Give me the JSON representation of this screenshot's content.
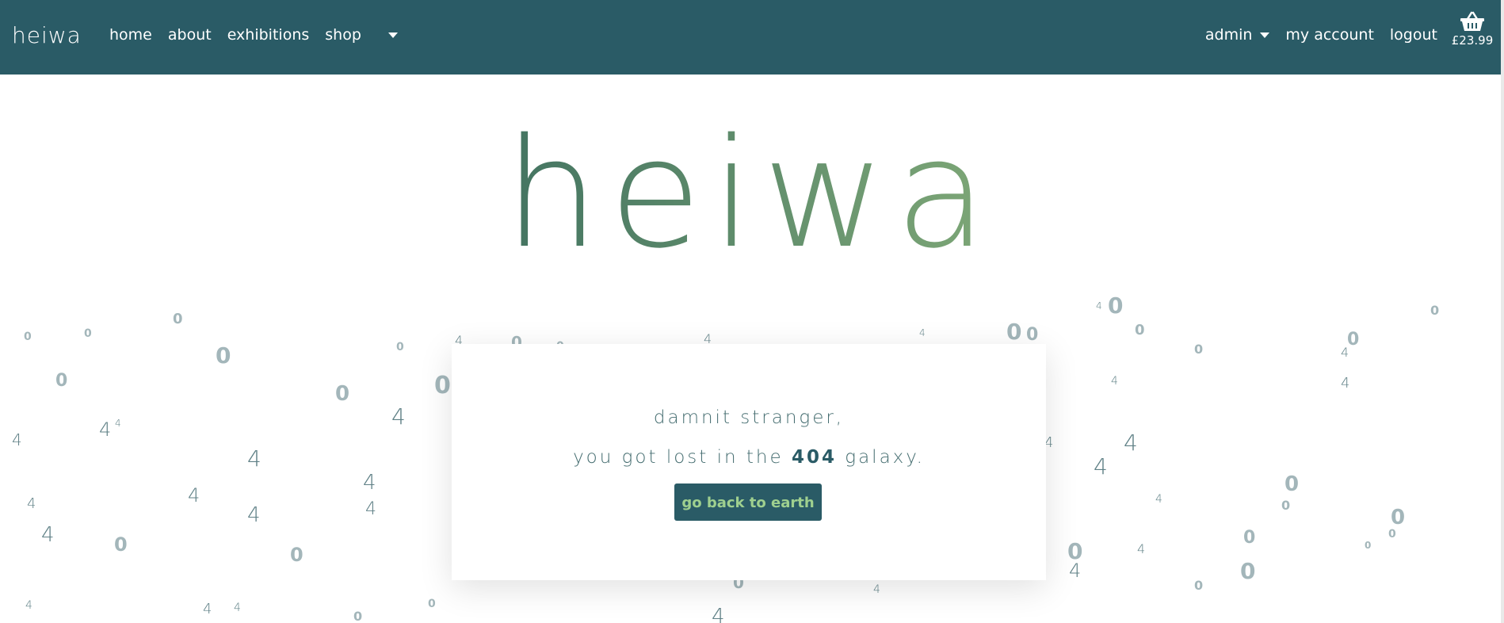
{
  "navbar": {
    "brand": "heiwa",
    "links": {
      "home": "home",
      "about": "about",
      "exhibitions": "exhibitions",
      "shop": "shop"
    },
    "admin": "admin",
    "my_account": "my account",
    "logout": "logout",
    "basket_total": "£23.99"
  },
  "hero": {
    "logo": "heiwa"
  },
  "error": {
    "line1": "damnit stranger,",
    "line2_before": "you got lost in the",
    "code": "404",
    "line2_after": "galaxy.",
    "button": "go back to earth"
  },
  "background": {
    "digit_four": "4",
    "digit_zero": "0"
  },
  "colors": {
    "navbar": "#2a5b66",
    "logo_gradient_start": "#3d6e5f",
    "logo_gradient_end": "#84ad79",
    "button_text": "#9fd08f"
  },
  "icons": {
    "basket": "basket-icon",
    "dropdown": "caret-down-icon"
  }
}
